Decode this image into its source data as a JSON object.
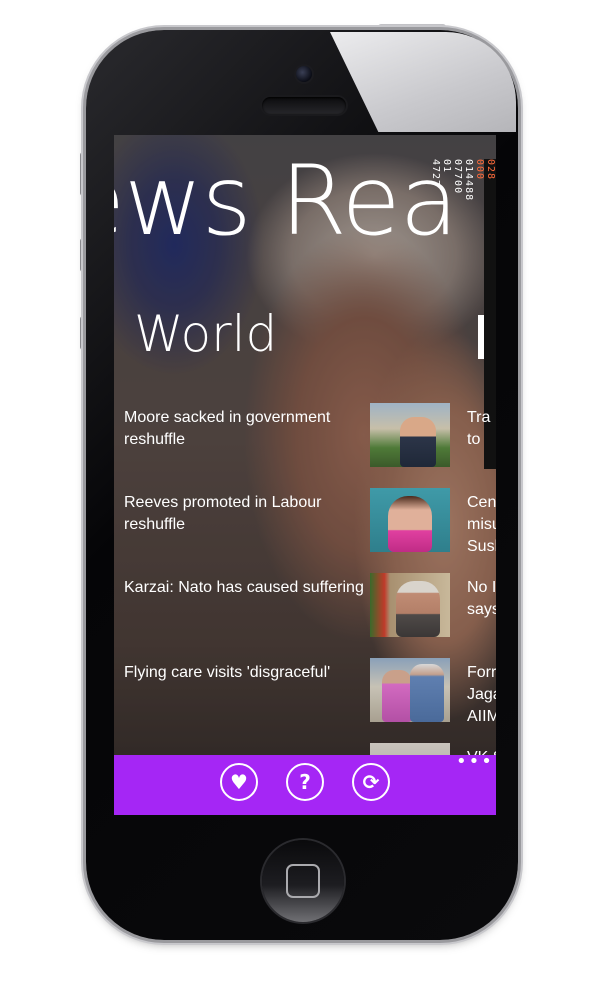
{
  "app": {
    "title": "ews Rea",
    "section": "World",
    "ticker": [
      "028",
      "000",
      "014488",
      "07700",
      "01",
      "4727"
    ]
  },
  "news": [
    {
      "headline": "Moore sacked in government reshuffle",
      "right_fragment": "Tra\nto"
    },
    {
      "headline": "Reeves promoted in Labour reshuffle",
      "right_fragment": "Cen\nmisu\nSush"
    },
    {
      "headline": "Karzai: Nato has caused suffering",
      "right_fragment": "No I\nsays"
    },
    {
      "headline": "Flying care visits 'disgraceful'",
      "right_fragment": "Forr\nJaga\nAIIM"
    },
    {
      "headline": "...",
      "right_fragment": "VK S"
    }
  ],
  "appbar": {
    "buttons": [
      {
        "name": "favorite-button",
        "icon": "heart-icon",
        "glyph": "♥"
      },
      {
        "name": "help-button",
        "icon": "question-icon",
        "glyph": "?"
      },
      {
        "name": "refresh-button",
        "icon": "refresh-icon",
        "glyph": "⟳"
      }
    ],
    "more": "•••",
    "color": "#a526f5"
  }
}
